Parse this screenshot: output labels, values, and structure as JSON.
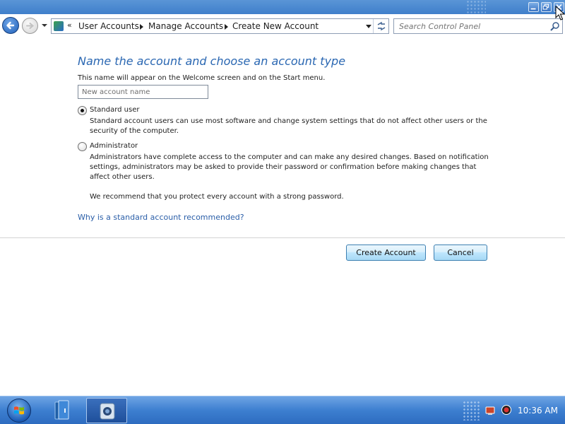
{
  "window": {
    "controls": [
      "minimize",
      "restore",
      "close"
    ]
  },
  "navbar": {
    "address_prefix": "«",
    "breadcrumbs": [
      "User Accounts",
      "Manage Accounts",
      "Create New Account"
    ],
    "search_placeholder": "Search Control Panel"
  },
  "content": {
    "heading": "Name the account and choose an account type",
    "description": "This name will appear on the Welcome screen and on the Start menu.",
    "name_input": {
      "value": "",
      "placeholder": "New account name"
    },
    "options": [
      {
        "label": "Standard user",
        "selected": true,
        "description": "Standard account users can use most software and change system settings that do not affect other users or the security of the computer."
      },
      {
        "label": "Administrator",
        "selected": false,
        "description": "Administrators have complete access to the computer and can make any desired changes. Based on notification settings, administrators may be asked to provide their password or confirmation before making changes that affect other users.",
        "recommendation": "We recommend that you protect every account with a strong password."
      }
    ],
    "help_link": "Why is a standard account recommended?"
  },
  "buttons": {
    "create": "Create Account",
    "cancel": "Cancel"
  },
  "taskbar": {
    "clock": "10:36 AM",
    "tray_icons": [
      "network-icon",
      "volume-icon"
    ]
  },
  "colors": {
    "heading": "#2a67b2",
    "link": "#2a5ea8",
    "taskbar": "#3d7fd0"
  }
}
